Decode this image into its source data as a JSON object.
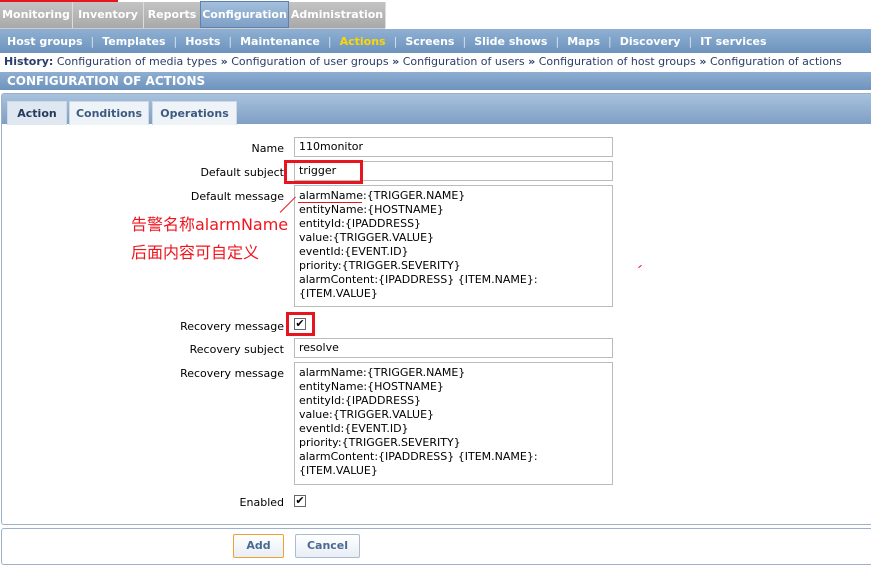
{
  "top_tabs": [
    "Monitoring",
    "Inventory",
    "Reports",
    "Configuration",
    "Administration"
  ],
  "sub_nav": [
    "Host groups",
    "Templates",
    "Hosts",
    "Maintenance",
    "Actions",
    "Screens",
    "Slide shows",
    "Maps",
    "Discovery",
    "IT services"
  ],
  "history": {
    "label": "History:",
    "items": [
      "Configuration of media types",
      "Configuration of user groups",
      "Configuration of users",
      "Configuration of host groups",
      "Configuration of actions"
    ]
  },
  "header": "CONFIGURATION OF ACTIONS",
  "form_tabs": [
    "Action",
    "Conditions",
    "Operations"
  ],
  "form": {
    "name_label": "Name",
    "name_value": "110monitor",
    "subject_label": "Default subject",
    "subject_value": "trigger",
    "message_label": "Default message",
    "message_value": "alarmName:{TRIGGER.NAME}\nentityName:{HOSTNAME}\nentityId:{IPADDRESS}\nvalue:{TRIGGER.VALUE}\neventId:{EVENT.ID}\npriority:{TRIGGER.SEVERITY}\nalarmContent:{IPADDRESS} {ITEM.NAME}:\n{ITEM.VALUE}",
    "recovery_label": "Recovery message",
    "recovery_checked": "✔",
    "recovery_subject_label": "Recovery subject",
    "recovery_subject_value": "resolve",
    "recovery_message_label": "Recovery message",
    "recovery_message_value": "alarmName:{TRIGGER.NAME}\nentityName:{HOSTNAME}\nentityId:{IPADDRESS}\nvalue:{TRIGGER.VALUE}\neventId:{EVENT.ID}\npriority:{TRIGGER.SEVERITY}\nalarmContent:{IPADDRESS} {ITEM.NAME}:\n{ITEM.VALUE}",
    "enabled_label": "Enabled",
    "enabled_checked": "✔"
  },
  "buttons": {
    "add": "Add",
    "cancel": "Cancel"
  },
  "annotation": {
    "line1": "告警名称alarmName",
    "line2": "后面内容可自定义"
  }
}
